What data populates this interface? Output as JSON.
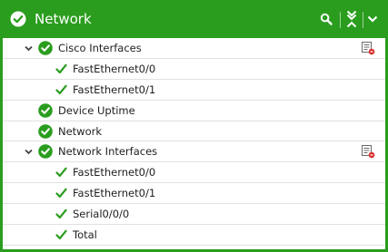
{
  "header": {
    "title": "Network",
    "status_icon": "check-circle-icon",
    "search_icon": "search-icon",
    "collapse_icon": "collapse-all-icon",
    "menu_icon": "chevron-down-icon",
    "background_color": "#2a9d1e"
  },
  "tree": {
    "status_color": "#2a9d1e",
    "row_divider_color": "#e1e1e1",
    "nodes": [
      {
        "label": "Cisco Interfaces",
        "level": 1,
        "icon": "check-circle-icon",
        "expanded": true,
        "action_icon": "edit-report-icon"
      },
      {
        "label": "FastEthernet0/0",
        "level": 2,
        "icon": "check-icon"
      },
      {
        "label": "FastEthernet0/1",
        "level": 2,
        "icon": "check-icon"
      },
      {
        "label": "Device Uptime",
        "level": 1,
        "icon": "check-circle-icon"
      },
      {
        "label": "Network",
        "level": 1,
        "icon": "check-circle-icon"
      },
      {
        "label": "Network Interfaces",
        "level": 1,
        "icon": "check-circle-icon",
        "expanded": true,
        "action_icon": "edit-report-icon"
      },
      {
        "label": "FastEthernet0/0",
        "level": 2,
        "icon": "check-icon"
      },
      {
        "label": "FastEthernet0/1",
        "level": 2,
        "icon": "check-icon"
      },
      {
        "label": "Serial0/0/0",
        "level": 2,
        "icon": "check-icon"
      },
      {
        "label": "Total",
        "level": 2,
        "icon": "check-icon"
      }
    ]
  }
}
